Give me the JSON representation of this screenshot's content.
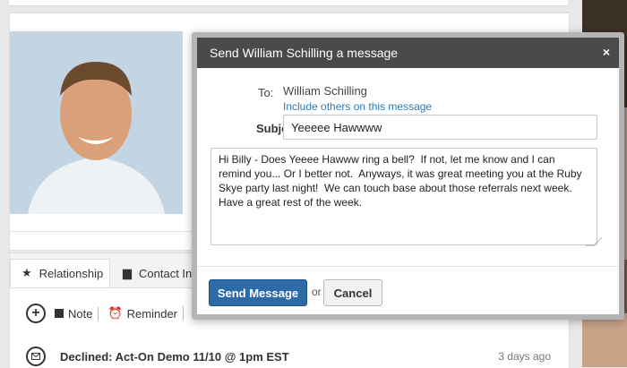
{
  "profile": {
    "tabs": [
      "Relationship",
      "Contact Info"
    ],
    "actions": {
      "note": "Note",
      "reminder": "Reminder"
    },
    "activity": {
      "text": "Declined: Act-On Demo 11/10 @ 1pm EST",
      "time": "3 days ago"
    }
  },
  "modal": {
    "title": "Send William Schilling a message",
    "close": "×",
    "to_label": "To:",
    "to_name": "William Schilling",
    "include_link": "Include others on this message",
    "subject_label": "Subject:",
    "subject_value": "Yeeeee Hawwww",
    "message_value": "Hi Billy - Does Yeeee Hawww ring a bell?  If not, let me know and I can remind you... Or I better not.  Anyways, it was great meeting you at the Ruby Skye party last night!  We can touch base about those referrals next week.  Have a great rest of the week.",
    "send_label": "Send Message",
    "or_text": "or",
    "cancel_label": "Cancel"
  },
  "colors": {
    "header_bg": "#4a4a4a",
    "primary_button": "#2d6aa8",
    "link": "#2a7ab8"
  }
}
